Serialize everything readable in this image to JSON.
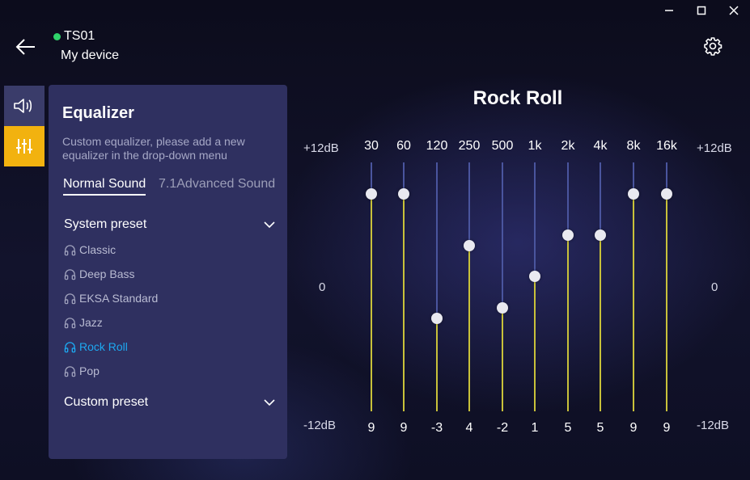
{
  "device": {
    "name": "TS01",
    "subtitle": "My device",
    "status_color": "#2fd36a"
  },
  "panel": {
    "title": "Equalizer",
    "description": "Custom equalizer, please add a new equalizer in the drop-down menu",
    "tabs": [
      {
        "label": "Normal Sound",
        "active": true
      },
      {
        "label": "7.1Advanced Sound",
        "active": false
      }
    ],
    "system_preset_label": "System preset",
    "custom_preset_label": "Custom preset",
    "presets": [
      {
        "label": "Classic",
        "selected": false
      },
      {
        "label": "Deep Bass",
        "selected": false
      },
      {
        "label": "EKSA Standard",
        "selected": false
      },
      {
        "label": "Jazz",
        "selected": false
      },
      {
        "label": "Rock Roll",
        "selected": true
      },
      {
        "label": "Pop",
        "selected": false
      }
    ]
  },
  "eq": {
    "title": "Rock Roll",
    "scale": {
      "top": "+12dB",
      "mid": "0",
      "bottom": "-12dB",
      "min": -12,
      "max": 12
    },
    "bands": [
      {
        "freq": "30",
        "value": 9
      },
      {
        "freq": "60",
        "value": 9
      },
      {
        "freq": "120",
        "value": -3
      },
      {
        "freq": "250",
        "value": 4
      },
      {
        "freq": "500",
        "value": -2
      },
      {
        "freq": "1k",
        "value": 1
      },
      {
        "freq": "2k",
        "value": 5
      },
      {
        "freq": "4k",
        "value": 5
      },
      {
        "freq": "8k",
        "value": 9
      },
      {
        "freq": "16k",
        "value": 9
      }
    ]
  },
  "colors": {
    "accent": "#f2b20f",
    "selected_preset": "#1da8f0",
    "slider_fill": "#c8c13a",
    "slider_track": "#4a559e"
  }
}
